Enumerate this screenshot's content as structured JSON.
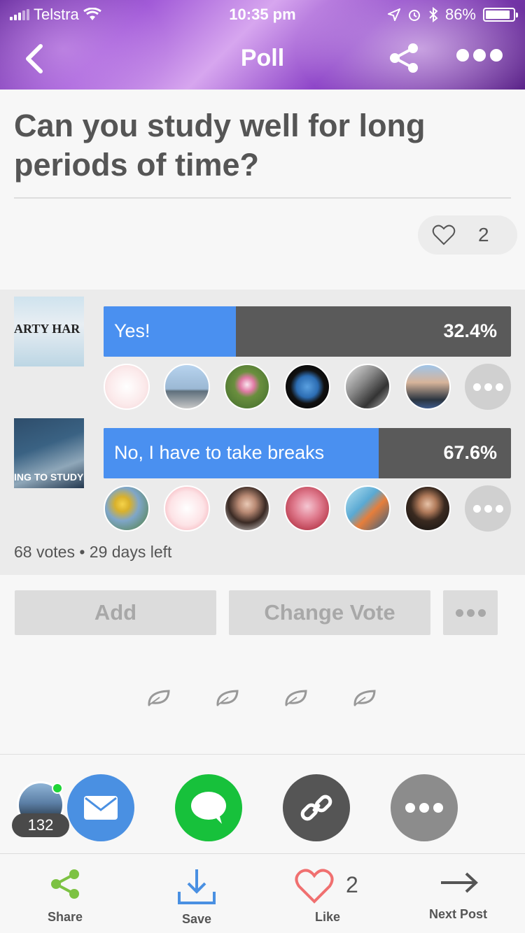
{
  "status_bar": {
    "carrier": "Telstra",
    "time": "10:35 pm",
    "battery": "86%"
  },
  "nav": {
    "title": "Poll",
    "icons": [
      "back-arrow-icon",
      "share-icon",
      "more-icon"
    ]
  },
  "poll": {
    "title": "Can you study well for long periods of time?",
    "like_count": "2",
    "options": [
      {
        "label": "Yes!",
        "percent_text": "32.4%",
        "percent": 32.4,
        "thumb_text": "ARTY HAR"
      },
      {
        "label": "No, I have to take breaks",
        "percent_text": "67.6%",
        "percent": 67.6,
        "thumb_text": "ING TO STUDY"
      }
    ],
    "meta": "68 votes • 29 days left"
  },
  "actions": {
    "add_label": "Add",
    "change_vote_label": "Change Vote"
  },
  "share_strip": {
    "viewer_count": "132",
    "icons": [
      "mail-icon",
      "message-icon",
      "link-icon",
      "more-icon"
    ]
  },
  "bottom_bar": {
    "share_label": "Share",
    "save_label": "Save",
    "like_label": "Like",
    "like_count": "2",
    "next_label": "Next Post"
  },
  "colors": {
    "accent_blue": "#4a90f0",
    "bar_gray": "#5a5a5a",
    "share_green": "#7dc243",
    "save_blue": "#4a90e2",
    "like_red": "#f07070"
  }
}
